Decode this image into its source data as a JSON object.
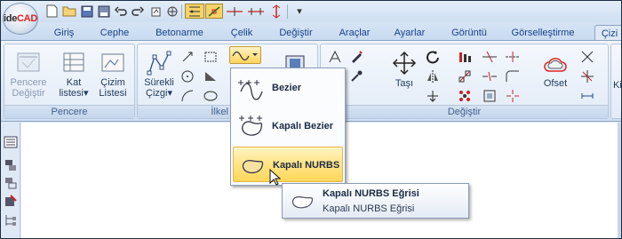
{
  "app": {
    "logo_prefix": "ide",
    "logo_suffix": "CAD"
  },
  "quick_access": {
    "icons": [
      "new-file-icon",
      "open-folder-icon",
      "save-icon",
      "save-as-icon",
      "undo-icon",
      "redo-icon",
      "refresh-icon",
      "snap-grid-icon",
      "snap-point-icon",
      "axis-icon",
      "measure-icon",
      "dimension-icon"
    ],
    "menu_arrow": "▾"
  },
  "tabs": [
    "Giriş",
    "Cephe",
    "Betonarme",
    "Çelik",
    "Değiştir",
    "Araçlar",
    "Ayarlar",
    "Görüntü",
    "Görselleştirme",
    "Çizi"
  ],
  "active_tab": "Çizi",
  "ribbon": {
    "pencere": {
      "label": "Pencere",
      "btn_label": "Pencere Değiştir"
    },
    "kat": {
      "line1": "Kat",
      "line2": "listesi"
    },
    "cizim": {
      "line1": "Çizim",
      "line2": "Listesi"
    },
    "group2_label": "Pencere",
    "surekli": {
      "line1": "Sürekli",
      "line2": "Çizgi"
    },
    "ilkel_label": "İlkel Öğ",
    "tasi": "Taşı",
    "ofset": "Ofset",
    "degistir_label": "Değiştir",
    "ki": "Ki"
  },
  "dropdown": {
    "items": [
      {
        "label": "Bezier",
        "icon": "bezier-icon"
      },
      {
        "label": "Kapalı Bezier",
        "icon": "closed-bezier-icon"
      },
      {
        "label": "Kapalı NURBS",
        "icon": "closed-nurbs-icon",
        "highlighted": true
      }
    ]
  },
  "tooltip": {
    "title": "Kapalı NURBS Eğrisi",
    "description": "Kapalı NURBS Eğrisi"
  },
  "colors": {
    "accent": "#ffd75a",
    "tab_text": "#15428b",
    "ribbon_bg": "#dfe9f5"
  }
}
